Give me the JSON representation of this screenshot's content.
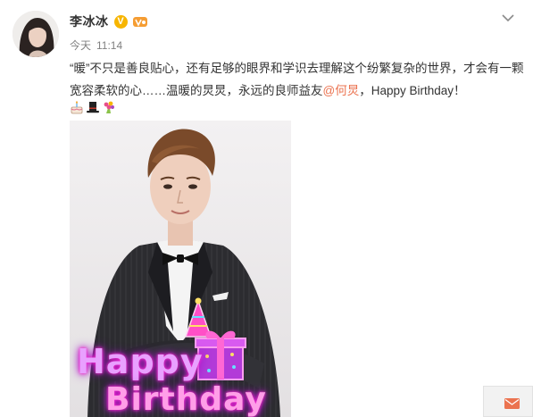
{
  "post": {
    "username": "李冰冰",
    "verified_badge": "V",
    "time_day": "今天",
    "time_clock": "11:14",
    "text_before_mention": "“暖”不只是善良贴心，还有足够的眼界和学识去理解这个纷繁复杂的世界，才会有一颗宽容柔软的心……温暖的炅炅，永远的良师益友",
    "mention": "@何炅",
    "text_after_mention": "，Happy Birthday！",
    "emojis": [
      "birthday-cake-icon",
      "top-hat-icon",
      "bouquet-icon"
    ],
    "image_overlay": {
      "line1": "Happy",
      "line2": "Birthday"
    }
  },
  "icons": {
    "dropdown": "chevron-down-icon",
    "verified": "verified-v-icon",
    "level": "vip-level-icon",
    "message": "mail-icon"
  },
  "colors": {
    "username": "#333333",
    "timestamp": "#808080",
    "mention": "#eb7350",
    "verified_badge": "#f7b500",
    "mail_button": "#eb7350",
    "overlay_glow": "#ff2fd1"
  }
}
